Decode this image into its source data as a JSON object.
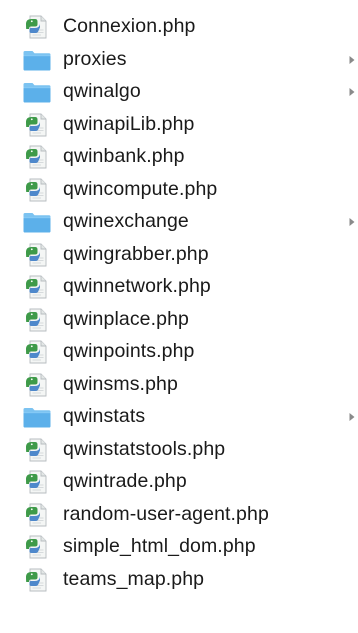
{
  "files": [
    {
      "name": "Connexion.php",
      "type": "file",
      "icon": "php-file-icon"
    },
    {
      "name": "proxies",
      "type": "folder",
      "icon": "folder-icon"
    },
    {
      "name": "qwinalgo",
      "type": "folder",
      "icon": "folder-icon"
    },
    {
      "name": "qwinapiLib.php",
      "type": "file",
      "icon": "php-file-icon"
    },
    {
      "name": "qwinbank.php",
      "type": "file",
      "icon": "php-file-icon"
    },
    {
      "name": "qwincompute.php",
      "type": "file",
      "icon": "php-file-icon"
    },
    {
      "name": "qwinexchange",
      "type": "folder",
      "icon": "folder-icon"
    },
    {
      "name": "qwingrabber.php",
      "type": "file",
      "icon": "php-file-icon"
    },
    {
      "name": "qwinnetwork.php",
      "type": "file",
      "icon": "php-file-icon"
    },
    {
      "name": "qwinplace.php",
      "type": "file",
      "icon": "php-file-icon"
    },
    {
      "name": "qwinpoints.php",
      "type": "file",
      "icon": "php-file-icon"
    },
    {
      "name": "qwinsms.php",
      "type": "file",
      "icon": "php-file-icon"
    },
    {
      "name": "qwinstats",
      "type": "folder",
      "icon": "folder-icon"
    },
    {
      "name": "qwinstatstools.php",
      "type": "file",
      "icon": "php-file-icon"
    },
    {
      "name": "qwintrade.php",
      "type": "file",
      "icon": "php-file-icon"
    },
    {
      "name": "random-user-agent.php",
      "type": "file",
      "icon": "php-file-icon"
    },
    {
      "name": "simple_html_dom.php",
      "type": "file",
      "icon": "php-file-icon"
    },
    {
      "name": "teams_map.php",
      "type": "file",
      "icon": "php-file-icon"
    }
  ],
  "colors": {
    "folder_body": "#5cb0ea",
    "folder_tab": "#7cc3f1",
    "disclosure": "#8a8a8a",
    "file_bg": "#f4f6f5",
    "file_border": "#b7bcc0",
    "file_script_green": "#3e9a49",
    "file_script_blue": "#3d7dc8"
  }
}
